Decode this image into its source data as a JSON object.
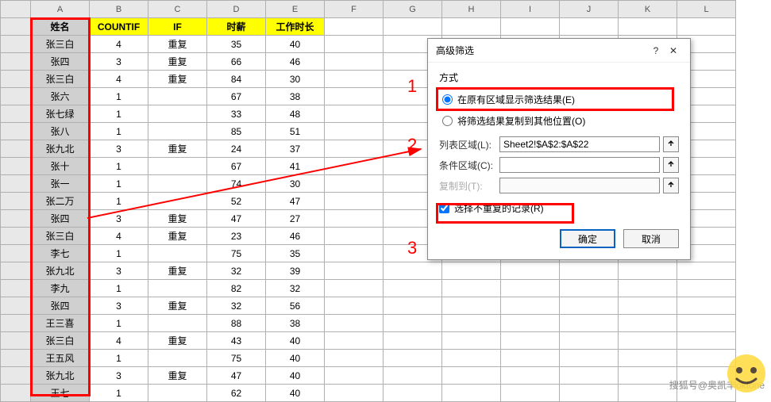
{
  "columns": [
    "A",
    "B",
    "C",
    "D",
    "E",
    "F",
    "G",
    "H",
    "I",
    "J",
    "K",
    "L"
  ],
  "headers": {
    "A": "姓名",
    "B": "COUNTIF",
    "C": "IF",
    "D": "时薪",
    "E": "工作时长"
  },
  "rows": [
    {
      "a": "张三白",
      "b": "4",
      "c": "重复",
      "d": "35",
      "e": "40"
    },
    {
      "a": "张四",
      "b": "3",
      "c": "重复",
      "d": "66",
      "e": "46"
    },
    {
      "a": "张三白",
      "b": "4",
      "c": "重复",
      "d": "84",
      "e": "30"
    },
    {
      "a": "张六",
      "b": "1",
      "c": "",
      "d": "67",
      "e": "38"
    },
    {
      "a": "张七绿",
      "b": "1",
      "c": "",
      "d": "33",
      "e": "48"
    },
    {
      "a": "张八",
      "b": "1",
      "c": "",
      "d": "85",
      "e": "51"
    },
    {
      "a": "张九北",
      "b": "3",
      "c": "重复",
      "d": "24",
      "e": "37"
    },
    {
      "a": "张十",
      "b": "1",
      "c": "",
      "d": "67",
      "e": "41"
    },
    {
      "a": "张一",
      "b": "1",
      "c": "",
      "d": "74",
      "e": "30"
    },
    {
      "a": "张二万",
      "b": "1",
      "c": "",
      "d": "52",
      "e": "47"
    },
    {
      "a": "张四",
      "b": "3",
      "c": "重复",
      "d": "47",
      "e": "27"
    },
    {
      "a": "张三白",
      "b": "4",
      "c": "重复",
      "d": "23",
      "e": "46"
    },
    {
      "a": "李七",
      "b": "1",
      "c": "",
      "d": "75",
      "e": "35"
    },
    {
      "a": "张九北",
      "b": "3",
      "c": "重复",
      "d": "32",
      "e": "39"
    },
    {
      "a": "李九",
      "b": "1",
      "c": "",
      "d": "82",
      "e": "32"
    },
    {
      "a": "张四",
      "b": "3",
      "c": "重复",
      "d": "32",
      "e": "56"
    },
    {
      "a": "王三喜",
      "b": "1",
      "c": "",
      "d": "88",
      "e": "38"
    },
    {
      "a": "张三白",
      "b": "4",
      "c": "重复",
      "d": "43",
      "e": "40"
    },
    {
      "a": "王五风",
      "b": "1",
      "c": "",
      "d": "75",
      "e": "40"
    },
    {
      "a": "张九北",
      "b": "3",
      "c": "重复",
      "d": "47",
      "e": "40"
    },
    {
      "a": "王七",
      "b": "1",
      "c": "",
      "d": "62",
      "e": "40"
    }
  ],
  "dialog": {
    "title": "高级筛选",
    "help": "?",
    "close": "✕",
    "group_mode": "方式",
    "radio1": "在原有区域显示筛选结果(E)",
    "radio2": "将筛选结果复制到其他位置(O)",
    "label_list": "列表区域(L):",
    "value_list": "Sheet2!$A$2:$A$22",
    "label_cond": "条件区域(C):",
    "value_cond": "",
    "label_copy": "复制到(T):",
    "value_copy": "",
    "check_unique": "选择不重复的记录(R)",
    "btn_ok": "确定",
    "btn_cancel": "取消"
  },
  "annotations": {
    "n1": "1",
    "n2": "2",
    "n3": "3"
  },
  "watermark": "搜狐号@奥凯丰okfone"
}
